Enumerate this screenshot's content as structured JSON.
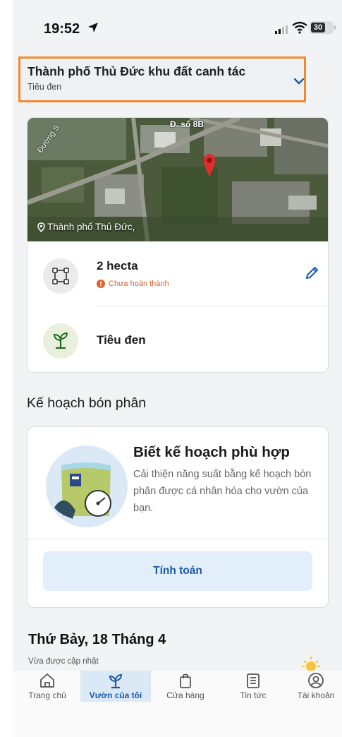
{
  "status_bar": {
    "time": "19:52",
    "battery": "30"
  },
  "header": {
    "title": "Thành phố Thủ Đức khu đất canh tác",
    "subtitle": "Tiêu đen"
  },
  "field": {
    "map_location_label": "Thành phố Thủ Đức,",
    "road_label_top": "Đ. số 8B",
    "road_label_left": "Đường S",
    "area_value": "2 hecta",
    "area_status": "Chưa hoàn thành",
    "crop_name": "Tiêu đen"
  },
  "fertilizer_plan": {
    "section_title": "Kế hoạch bón phân",
    "card_title": "Biết kế hoạch phù hợp",
    "card_description": "Cải thiện năng suất bằng kế hoạch bón phân được cá nhân hóa cho vườn của bạn.",
    "calculate_label": "Tính toán"
  },
  "weather": {
    "date": "Thứ Bảy, 18 Tháng 4",
    "updated": "Vừa được cập nhật"
  },
  "bottom_nav": {
    "items": [
      {
        "label": "Trang chủ",
        "icon": "home-icon"
      },
      {
        "label": "Vườn của tôi",
        "icon": "sprout-icon"
      },
      {
        "label": "Cửa hàng",
        "icon": "shopping-bag-icon"
      },
      {
        "label": "Tin tức",
        "icon": "news-icon"
      },
      {
        "label": "Tài khoản",
        "icon": "account-icon"
      }
    ],
    "active_index": 1
  },
  "colors": {
    "accent_blue": "#1c5aa9",
    "highlight_orange": "#f08a2e",
    "warning_orange": "#d9642b",
    "button_bg": "#e2eefa"
  }
}
